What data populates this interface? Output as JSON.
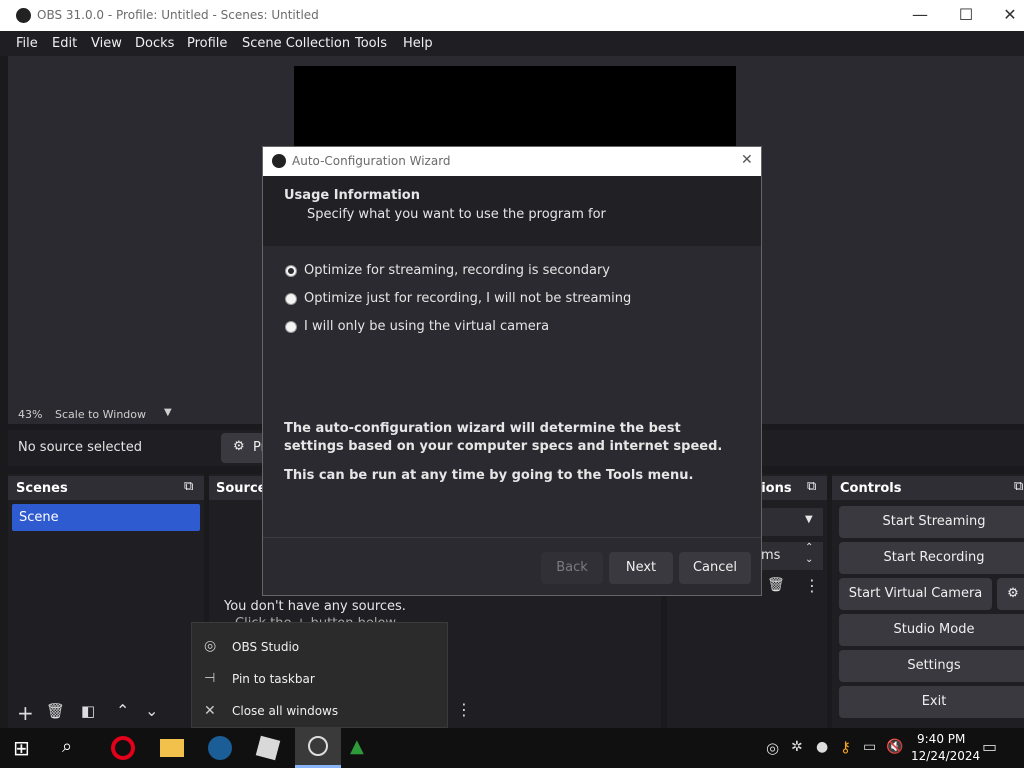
{
  "window": {
    "title": "OBS 31.0.0 - Profile: Untitled - Scenes: Untitled",
    "minimize": "—",
    "maximize": "☐",
    "close": "✕"
  },
  "menu": [
    "File",
    "Edit",
    "View",
    "Docks",
    "Profile",
    "Scene Collection",
    "Tools",
    "Help"
  ],
  "preview": {
    "zoom": "43%",
    "scale_mode": "Scale to Window"
  },
  "source_bar": {
    "status": "No source selected",
    "properties_label": "Pr"
  },
  "scenes": {
    "header": "Scenes",
    "items": [
      "Scene"
    ]
  },
  "sources": {
    "header": "Source",
    "empty_line1": "You don't have any sources.",
    "empty_line2": "Click the + button below,"
  },
  "transitions": {
    "header": "tions",
    "duration_suffix": "ms"
  },
  "controls": {
    "header": "Controls",
    "buttons": [
      "Start Streaming",
      "Start Recording",
      "Start Virtual Camera",
      "Studio Mode",
      "Settings",
      "Exit"
    ]
  },
  "dialog": {
    "title": "Auto-Configuration Wizard",
    "section_title": "Usage Information",
    "section_subtitle": "Specify what you want to use the program for",
    "options": [
      {
        "label": "Optimize for streaming, recording is secondary",
        "selected": true
      },
      {
        "label": "Optimize just for recording, I will not be streaming",
        "selected": false
      },
      {
        "label": "I will only be using the virtual camera",
        "selected": false
      }
    ],
    "info1": "The auto-configuration wizard will determine the best settings based on your computer specs and internet speed.",
    "info2": "This can be run at any time by going to the Tools menu.",
    "back": "Back",
    "next": "Next",
    "cancel": "Cancel"
  },
  "jumplist": {
    "app": "OBS Studio",
    "pin": "Pin to taskbar",
    "close_all": "Close all windows"
  },
  "taskbar": {
    "time": "9:40 PM",
    "date": "12/24/2024"
  },
  "colors": {
    "accent": "#2f5bd1",
    "dock_bg": "#1f1e22",
    "header_bg": "#2f2e35",
    "button_bg": "#3a3940"
  }
}
